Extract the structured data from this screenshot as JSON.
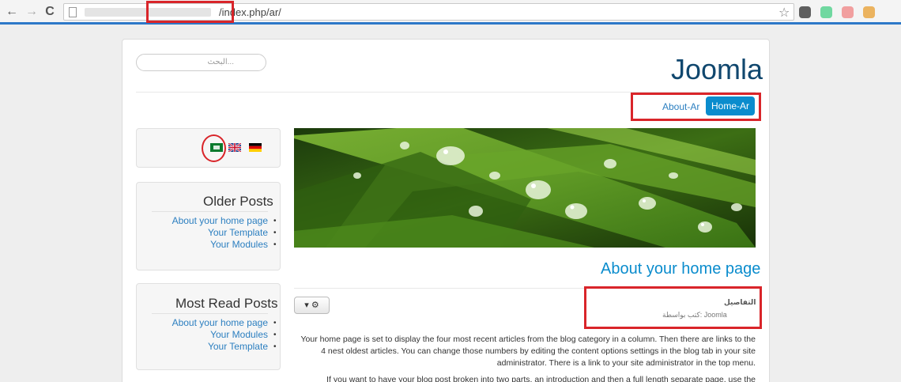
{
  "browser": {
    "url_path": "/index.php/ar/",
    "extension_colors": [
      "#3a3a3a",
      "#4fd18b",
      "#f08a8a",
      "#e8a23a"
    ]
  },
  "site": {
    "brand": "Joomla",
    "search_placeholder": "البحث...",
    "nav": {
      "about": "About-Ar",
      "home": "Home-Ar"
    }
  },
  "languages": {
    "flags": [
      "arabic-flag",
      "uk-flag",
      "german-flag"
    ]
  },
  "older_posts": {
    "title": "Older Posts",
    "links": [
      "About your home page",
      "Your Template",
      "Your Modules"
    ]
  },
  "most_read": {
    "title": "Most Read Posts",
    "links": [
      "About your home page",
      "Your Modules",
      "Your Template"
    ]
  },
  "article": {
    "title": "About your home page",
    "details_label": "التفاصيل",
    "written_by": "كتب بواسطة: Joomla",
    "para1": "Your home page is set to display the four most recent articles from the blog category in a column. Then there are links to the 4 nest oldest articles. You can change those numbers by editing the content options settings in the blog tab in your site administrator. There is a link to your site administrator in the top menu.",
    "para2": "If you want to have your blog post broken into two parts, an introduction and then a full length separate page, use the"
  }
}
